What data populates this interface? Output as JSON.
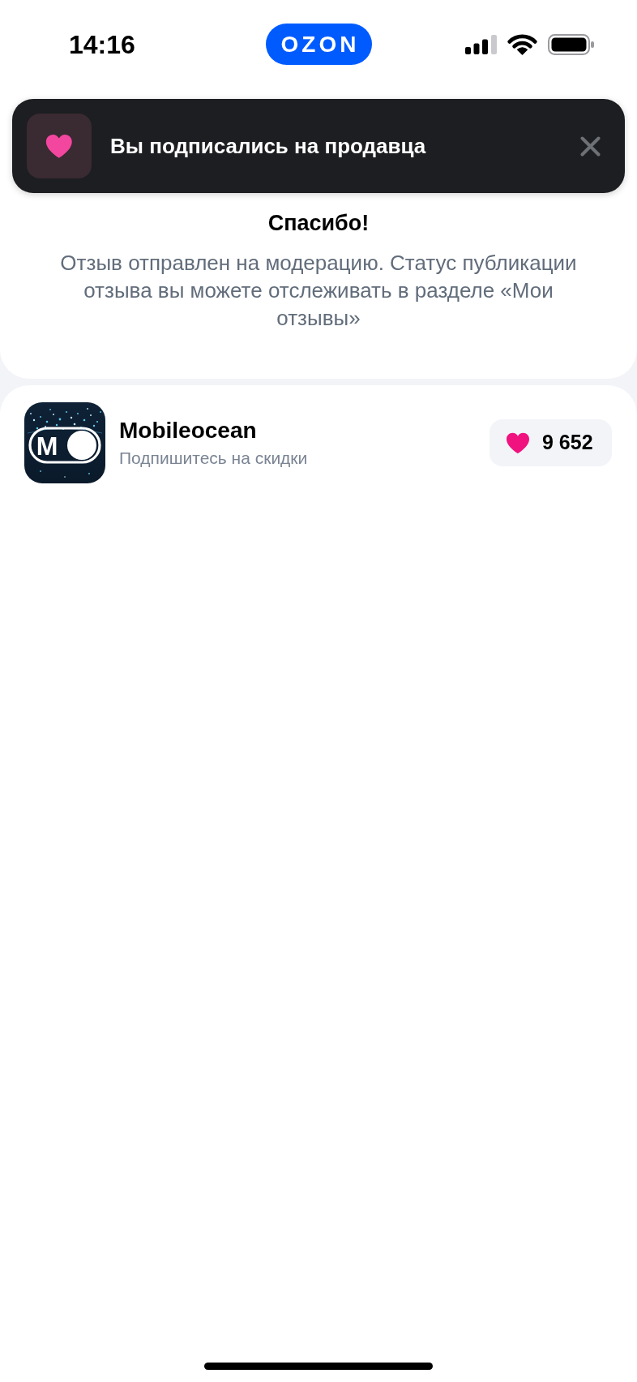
{
  "status_bar": {
    "time": "14:16",
    "app_badge": "OZON"
  },
  "toast": {
    "message": "Вы подписались на продавца"
  },
  "confirmation": {
    "title": "Спасибо!",
    "message": "Отзыв отправлен на модерацию. Статус публикации отзыва вы можете отслеживать в разделе «Мои отзывы»"
  },
  "seller": {
    "logo_letter": "M",
    "name": "Mobileocean",
    "subtitle": "Подпишитесь на скидки",
    "subscribers": "9 652",
    "subscribed": true
  }
}
